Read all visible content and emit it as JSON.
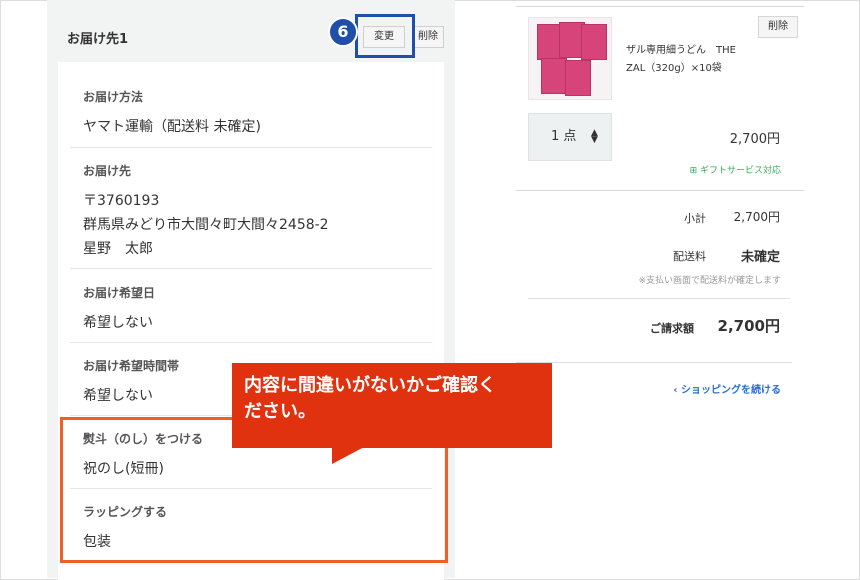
{
  "delivery": {
    "title": "お届け先1",
    "change_label": "変更",
    "delete_label": "削除",
    "sections": [
      {
        "label": "お届け方法",
        "value": "ヤマト運輸（配送料 未確定)"
      },
      {
        "label": "お届け先",
        "postal": "〒3760193",
        "address": "群馬県みどり市大間々町大間々2458-2",
        "name": "星野　太郎"
      },
      {
        "label": "お届け希望日",
        "value": "希望しない"
      },
      {
        "label": "お届け希望時間帯",
        "value": "希望しない"
      },
      {
        "label": "熨斗（のし）をつける",
        "value": "祝のし(短冊)"
      },
      {
        "label": "ラッピングする",
        "value": "包装"
      }
    ]
  },
  "annotation": {
    "step_number": "6",
    "callout_line1": "内容に間違いがないかご確認く",
    "callout_line2": "ださい。"
  },
  "cart": {
    "delete_label": "削除",
    "item_name_line1": "ザル専用細うどん　THE",
    "item_name_line2": "ZAL（320g）×10袋",
    "quantity": "1 点",
    "quantity_arrows": "▲▼",
    "price": "2,700円",
    "gift_label": "ギフトサービス対応",
    "subtotal_label": "小計",
    "subtotal_value": "2,700円",
    "shipping_label": "配送料",
    "shipping_value": "未確定",
    "shipping_note": "※支払い画面で配送料が確定します",
    "total_label": "ご請求額",
    "total_value": "2,700円",
    "continue_label": "ショッピングを続ける"
  },
  "colors": {
    "accent_blue": "#1f4fa8",
    "highlight_orange": "#ef6024",
    "callout_red": "#e0320f",
    "gift_green": "#3caa5a",
    "link_blue": "#2a6fd0"
  }
}
